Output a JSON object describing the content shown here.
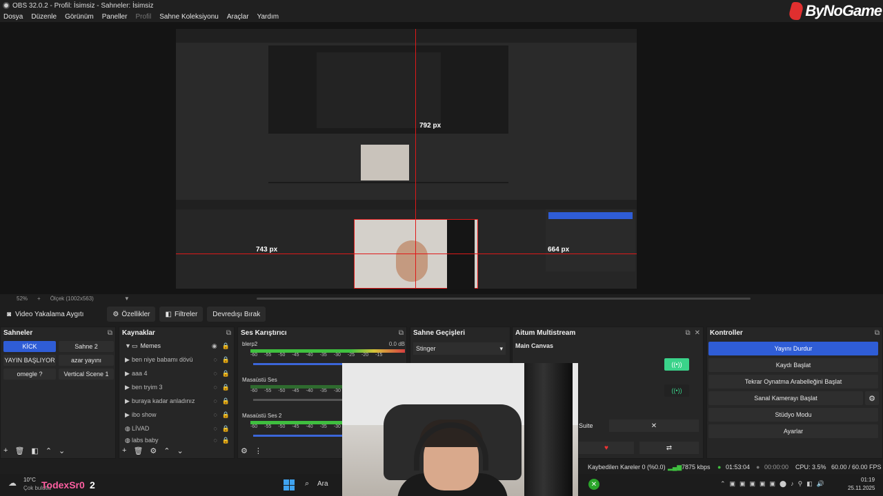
{
  "window": {
    "title": "OBS 32.0.2 - Profil: İsimsiz - Sahneler: İsimsiz",
    "brand": "ByNoGame"
  },
  "menu": [
    {
      "label": "Dosya"
    },
    {
      "label": "Düzenle"
    },
    {
      "label": "Görünüm"
    },
    {
      "label": "Paneller"
    },
    {
      "label": "Profil"
    },
    {
      "label": "Sahne Koleksiyonu"
    },
    {
      "label": "Araçlar"
    },
    {
      "label": "Yardım"
    }
  ],
  "preview": {
    "labels": {
      "top": "792 px",
      "left": "743 px",
      "right": "664 px"
    }
  },
  "zoom": {
    "level": "52%",
    "scale_label": "Ölçek (1002x563)"
  },
  "source_toolbar": {
    "device": "Video Yakalama Aygıtı",
    "properties": "Özellikler",
    "filters": "Filtreler",
    "deactivate": "Devredışı Bırak"
  },
  "scenes": {
    "title": "Sahneler",
    "items": [
      {
        "label": "KİCK",
        "active": true
      },
      {
        "label": "Sahne 2",
        "active": false
      },
      {
        "label": "YAYIN BAŞLIYOR",
        "active": false
      },
      {
        "label": "azar yayını",
        "active": false
      },
      {
        "label": "omegle ?",
        "active": false
      },
      {
        "label": "Vertical Scene 1",
        "active": false
      }
    ]
  },
  "sources": {
    "title": "Kaynaklar",
    "items": [
      {
        "label": "Memes",
        "type": "folder"
      },
      {
        "label": "ben niye babamı dövü",
        "type": "item"
      },
      {
        "label": "aaa 4",
        "type": "item"
      },
      {
        "label": "ben tryim 3",
        "type": "item"
      },
      {
        "label": "buraya kadar anladınız",
        "type": "item"
      },
      {
        "label": "ibo show",
        "type": "item"
      },
      {
        "label": "LİVAD",
        "type": "source"
      },
      {
        "label": "labs baby",
        "type": "source"
      }
    ]
  },
  "mixer": {
    "title": "Ses Karıştırıcı",
    "tracks": [
      {
        "name": "blerp2",
        "db": "0.0 dB",
        "level": 0.83
      },
      {
        "name": "Masaüstü Ses",
        "db": "",
        "level": 0.0
      },
      {
        "name": "Masaüstü Ses 2",
        "db": "",
        "level": 0.9
      }
    ],
    "scale": [
      "-60",
      "-55",
      "-50",
      "-45",
      "-40",
      "-35",
      "-30",
      "-25",
      "-20",
      "-15",
      "-10",
      "-5",
      "0"
    ]
  },
  "transitions": {
    "title": "Sahne Geçişleri",
    "selected": "Stinger"
  },
  "multistream": {
    "title": "Aitum Multistream",
    "canvas": "Main Canvas",
    "suite_label": "Suite"
  },
  "controls": {
    "title": "Kontroller",
    "buttons": [
      {
        "label": "Yayını Durdur",
        "primary": true
      },
      {
        "label": "Kaydı Başlat",
        "primary": false
      },
      {
        "label": "Tekrar Oynatma Arabelleğini Başlat",
        "primary": false
      },
      {
        "label": "Sanal Kamerayı Başlat",
        "primary": false
      },
      {
        "label": "Stüdyo Modu",
        "primary": false
      },
      {
        "label": "Ayarlar",
        "primary": false
      }
    ]
  },
  "status": {
    "dropped": "Kaybedilen Kareler 0 (%0.0)",
    "bitrate": "7875 kbps",
    "stream_time": "01:53:04",
    "rec_time": "00:00:00",
    "cpu": "CPU: 3.5%",
    "fps": "60.00 / 60.00 FPS"
  },
  "taskbar": {
    "weather_temp": "10°C",
    "weather_desc": "Çok bulutlu",
    "overlay_name": "TodexSr0",
    "overlay_num": "2",
    "search": "Ara",
    "time": "01:19",
    "date": "25.11.2025"
  }
}
